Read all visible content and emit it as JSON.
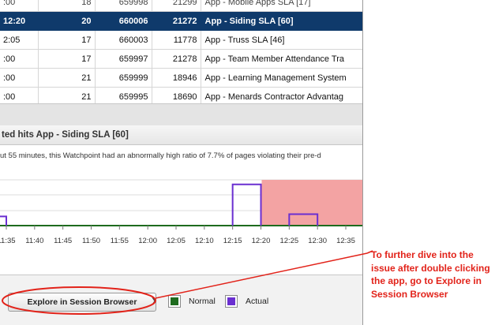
{
  "table": {
    "rows": [
      {
        "time": ":00",
        "count": "18",
        "id": "659998",
        "hits": "21299",
        "app": "App - Mobile Apps SLA [17]"
      },
      {
        "time": "12:20",
        "count": "20",
        "id": "660006",
        "hits": "21272",
        "app": "App - Siding SLA [60]"
      },
      {
        "time": "2:05",
        "count": "17",
        "id": "660003",
        "hits": "11778",
        "app": "App - Truss SLA [46]"
      },
      {
        "time": ":00",
        "count": "17",
        "id": "659997",
        "hits": "21278",
        "app": "App - Team Member Attendance Tra"
      },
      {
        "time": ":00",
        "count": "21",
        "id": "659999",
        "hits": "18946",
        "app": "App - Learning Management System"
      },
      {
        "time": ":00",
        "count": "21",
        "id": "659995",
        "hits": "18690",
        "app": "App - Menards Contractor Advantag"
      }
    ]
  },
  "detail": {
    "header": "ted hits App - Siding SLA [60]",
    "description": "ut 55 minutes, this Watchpoint had an abnormally high ratio of 7.7% of pages violating their pre-d"
  },
  "chart_data": {
    "type": "line",
    "x": [
      "11:35",
      "11:40",
      "11:45",
      "11:50",
      "11:55",
      "12:00",
      "12:05",
      "12:10",
      "12:15",
      "12:20",
      "12:25",
      "12:30",
      "12:35"
    ],
    "series": [
      {
        "name": "Normal",
        "values": [
          0,
          0,
          0,
          0,
          0,
          0,
          0,
          0,
          0,
          0,
          0,
          0,
          0
        ]
      },
      {
        "name": "Actual",
        "values": [
          0.2,
          0,
          0,
          0,
          0,
          0,
          0,
          0,
          0,
          0.9,
          0,
          0.25,
          0
        ]
      }
    ],
    "highlight_range": [
      "12:20",
      "12:37"
    ],
    "colors": {
      "normal": "#1e6b1e",
      "actual": "#6a2fd0",
      "highlight": "#f3a3a3"
    }
  },
  "footer": {
    "explore_label": "Explore in Session Browser",
    "legend_normal": "Normal",
    "legend_actual": "Actual"
  },
  "annotation": {
    "text": "To further dive into the issue after double clicking the app, go to Explore in Session Browser"
  }
}
